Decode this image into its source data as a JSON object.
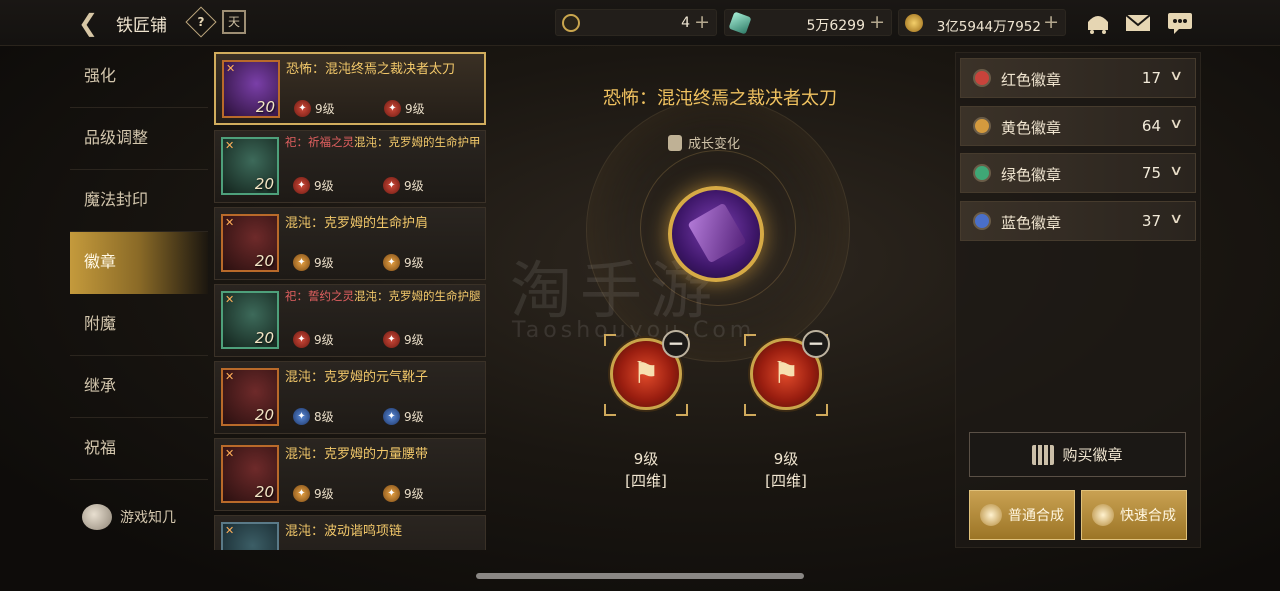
{
  "header": {
    "title": "铁匠铺",
    "help_glyph": "?",
    "calendar_glyph": "天",
    "currencies": [
      {
        "icon": "ticket-icon",
        "value": "4",
        "color": "#caa64e"
      },
      {
        "icon": "crystal-icon",
        "value": "5万6299",
        "color": "#5fb3a0"
      },
      {
        "icon": "gold-coin-icon",
        "value": "3亿5944万7952",
        "color": "#d7a53c"
      }
    ],
    "plus": "+"
  },
  "nav": {
    "items": [
      "强化",
      "品级调整",
      "魔法封印",
      "徽章",
      "附魔",
      "继承",
      "祝福"
    ],
    "active_index": 3,
    "extra_label": "游戏知几"
  },
  "items": [
    {
      "prefix": "",
      "name": "恐怖：混沌终焉之裁决者太刀",
      "level": "20",
      "badge_color": "red",
      "left_level": "9级",
      "right_level": "9级",
      "selected": true
    },
    {
      "prefix": "祀：祈福之灵",
      "name": "混沌：克罗姆的生命护甲",
      "level": "20",
      "badge_color": "red",
      "left_level": "9级",
      "right_level": "9级",
      "selected": false
    },
    {
      "prefix": "",
      "name": "混沌：克罗姆的生命护肩",
      "level": "20",
      "badge_color": "orange",
      "left_level": "9级",
      "right_level": "9级",
      "selected": false
    },
    {
      "prefix": "祀：誓约之灵",
      "name": "混沌：克罗姆的生命护腿",
      "level": "20",
      "badge_color": "red",
      "left_level": "9级",
      "right_level": "9级",
      "selected": false
    },
    {
      "prefix": "",
      "name": "混沌：克罗姆的元气靴子",
      "level": "20",
      "badge_color": "blue",
      "left_level": "8级",
      "right_level": "9级",
      "selected": false
    },
    {
      "prefix": "",
      "name": "混沌：克罗姆的力量腰带",
      "level": "20",
      "badge_color": "orange",
      "left_level": "9级",
      "right_level": "9级",
      "selected": false
    },
    {
      "prefix": "",
      "name": "混沌：波动谐鸣项链",
      "level": "20",
      "badge_color": "teal",
      "left_level": "",
      "right_level": "",
      "selected": false
    }
  ],
  "center": {
    "title": "恐怖：混沌终焉之裁决者太刀",
    "growth_label": "成长变化",
    "watermark": "淘手游",
    "watermark_sub": "Taoshouyou.Com",
    "slots": [
      {
        "level": "9级",
        "type": "[四维]",
        "glyph": "⚑"
      },
      {
        "level": "9级",
        "type": "[四维]",
        "glyph": "⚑"
      }
    ],
    "minus": "−"
  },
  "emblems": [
    {
      "label": "红色徽章",
      "count": "17",
      "color": "#c8433b"
    },
    {
      "label": "黄色徽章",
      "count": "64",
      "color": "#d49a3e"
    },
    {
      "label": "绿色徽章",
      "count": "75",
      "color": "#3fa776"
    },
    {
      "label": "蓝色徽章",
      "count": "37",
      "color": "#4a6fc9"
    }
  ],
  "actions": {
    "buy": "购买徽章",
    "normal_synth": "普通合成",
    "quick_synth": "快速合成"
  }
}
